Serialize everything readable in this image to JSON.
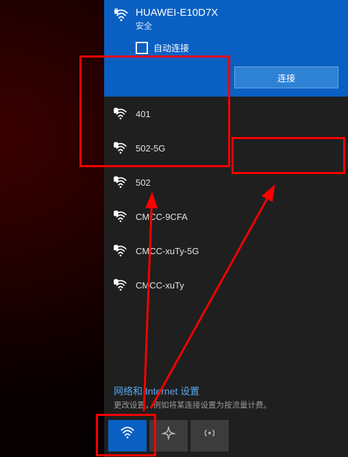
{
  "selected_network": {
    "name": "HUAWEI-E10D7X",
    "status": "安全",
    "auto_connect_label": "自动连接",
    "connect_button": "连接",
    "secured": true
  },
  "networks": [
    {
      "name": "401",
      "secured": true
    },
    {
      "name": "502-5G",
      "secured": true
    },
    {
      "name": "502",
      "secured": true
    },
    {
      "name": "CMCC-9CFA",
      "secured": true
    },
    {
      "name": "CMCC-xuTy-5G",
      "secured": true
    },
    {
      "name": "CMCC-xuTy",
      "secured": true
    }
  ],
  "footer": {
    "link": "网络和 Internet 设置",
    "desc": "更改设置，例如将某连接设置为按流量计费。"
  },
  "toggles": {
    "wlan": "WLAN",
    "airplane": "飞行模式",
    "hotspot": "移动热点"
  }
}
